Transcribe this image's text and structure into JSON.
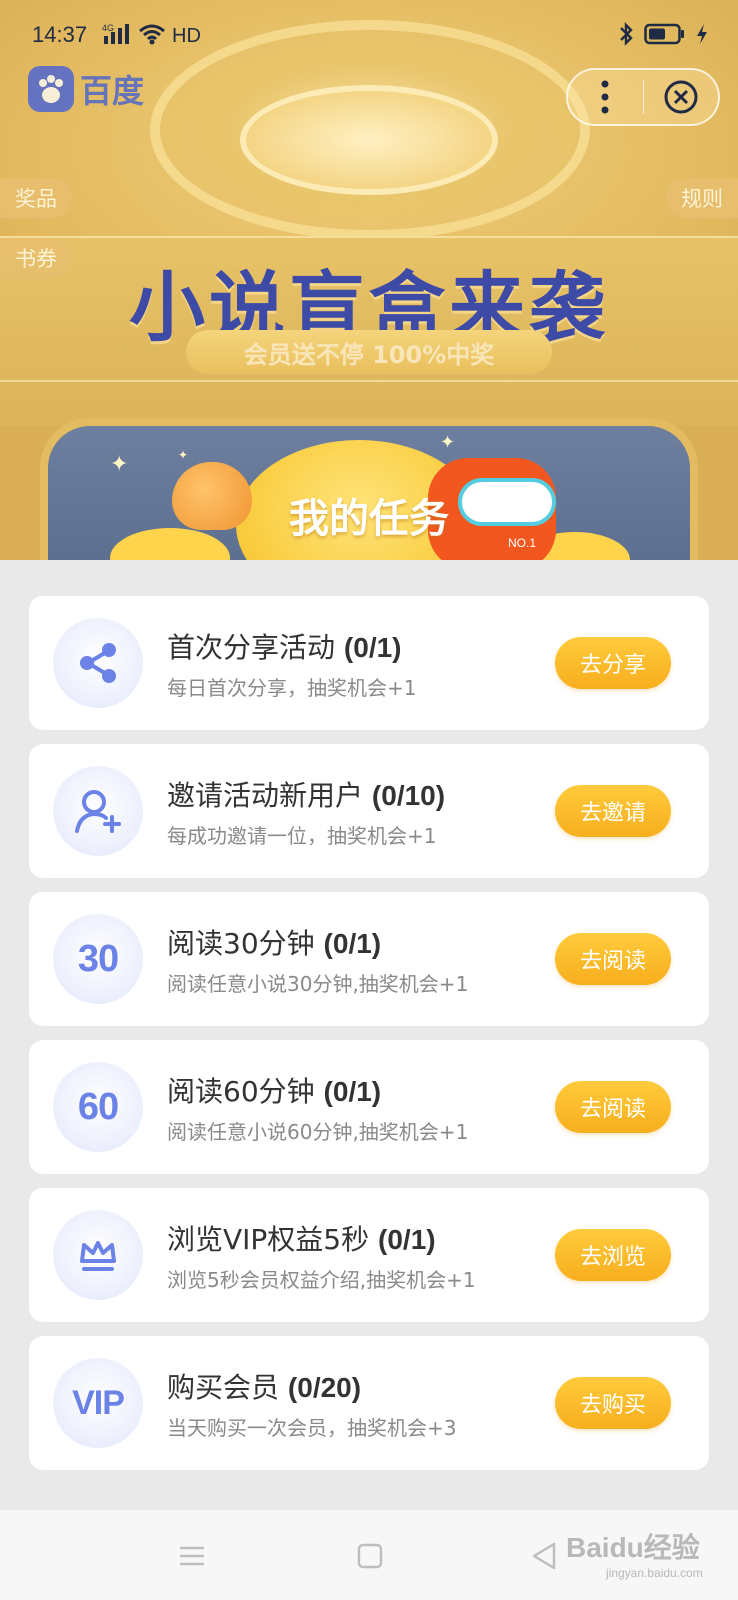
{
  "status_bar": {
    "time": "14:37",
    "network_type": "4G",
    "hd_label": "HD"
  },
  "app": {
    "name": "百度"
  },
  "hero": {
    "tag_prizes": "奖品",
    "tag_books": "书券",
    "tag_rules": "规则",
    "title": "小说盲盒来袭",
    "subtitle": "会员送不停 100%中奖",
    "tasks_label": "我的任务",
    "robot_tag": "NO.1"
  },
  "tasks": [
    {
      "icon": "share-icon",
      "title": "首次分享活动",
      "count": "(0/1)",
      "desc": "每日首次分享，抽奖机会+1",
      "button": "去分享"
    },
    {
      "icon": "invite-user-icon",
      "title": "邀请活动新用户",
      "count": "(0/10)",
      "desc": "每成功邀请一位，抽奖机会+1",
      "button": "去邀请"
    },
    {
      "icon": "30-minutes-icon",
      "icon_text": "30",
      "title": "阅读30分钟",
      "count": "(0/1)",
      "desc": "阅读任意小说30分钟,抽奖机会+1",
      "button": "去阅读"
    },
    {
      "icon": "60-minutes-icon",
      "icon_text": "60",
      "title": "阅读60分钟",
      "count": "(0/1)",
      "desc": "阅读任意小说60分钟,抽奖机会+1",
      "button": "去阅读"
    },
    {
      "icon": "crown-icon",
      "title": "浏览VIP权益5秒",
      "count": "(0/1)",
      "desc": "浏览5秒会员权益介绍,抽奖机会+1",
      "button": "去浏览"
    },
    {
      "icon": "vip-icon",
      "icon_text": "VIP",
      "title": "购买会员",
      "count": "(0/20)",
      "desc": "当天购买一次会员，抽奖机会+3",
      "button": "去购买"
    }
  ],
  "watermark": {
    "brand": "Baidu经验",
    "url": "jingyan.baidu.com"
  },
  "colors": {
    "accent_button": "#f7ae1e",
    "icon_blue": "#6b82e6",
    "title_navy": "#3d4aa6"
  }
}
